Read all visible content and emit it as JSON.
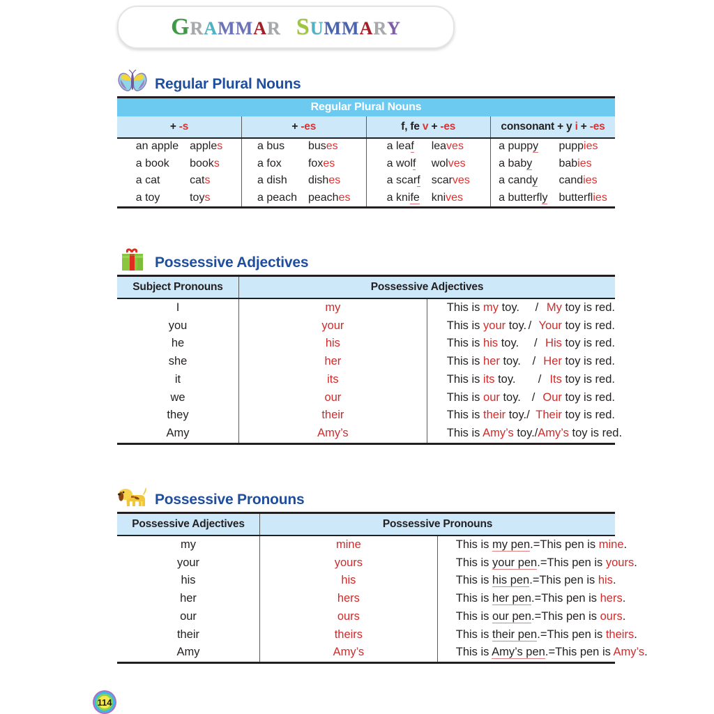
{
  "page": {
    "title_letters": [
      {
        "c": "G",
        "color": "#3f9a46",
        "big": true
      },
      {
        "c": "R",
        "color": "#a6a8ab",
        "big": false
      },
      {
        "c": "A",
        "color": "#4fb3c4",
        "big": false
      },
      {
        "c": "M",
        "color": "#6b73b8",
        "big": false
      },
      {
        "c": "M",
        "color": "#6b73b8",
        "big": false
      },
      {
        "c": "A",
        "color": "#a02028",
        "big": false
      },
      {
        "c": "R",
        "color": "#a6a8ab",
        "big": false
      },
      {
        "c": " ",
        "color": "#000000",
        "big": false
      },
      {
        "c": "S",
        "color": "#9fc63b",
        "big": true
      },
      {
        "c": "U",
        "color": "#4fb3c4",
        "big": false
      },
      {
        "c": "M",
        "color": "#4a63ad",
        "big": false
      },
      {
        "c": "M",
        "color": "#4a63ad",
        "big": false
      },
      {
        "c": "A",
        "color": "#a02028",
        "big": false
      },
      {
        "c": "R",
        "color": "#a6a8ab",
        "big": false
      },
      {
        "c": "Y",
        "color": "#7b5ea7",
        "big": false
      }
    ],
    "title_plain": "GRAMMAR SUMMARY",
    "page_number": "114",
    "accent_heading": "#1f4e9c",
    "accent_red": "#e03030",
    "bar_blue": "#6cc9ef",
    "subhead_blue": "#cde9f9"
  },
  "section1": {
    "icon": "butterfly-icon",
    "heading": "Regular Plural Nouns",
    "table_title": "Regular Plural Nouns",
    "columns": [
      {
        "prefix": "+ ",
        "suffix": "-s",
        "suffix_red": true,
        "mid": "",
        "mid_red": false,
        "tail": "",
        "tail_red": false
      },
      {
        "prefix": "+ ",
        "suffix": "-es",
        "suffix_red": true,
        "mid": "",
        "mid_red": false,
        "tail": "",
        "tail_red": false
      },
      {
        "prefix": "f, fe  ",
        "suffix": "v",
        "suffix_red": true,
        "mid": " + ",
        "mid_red": false,
        "tail": "-es",
        "tail_red": true
      },
      {
        "prefix": "consonant + y  ",
        "suffix": "i",
        "suffix_red": true,
        "mid": " + ",
        "mid_red": false,
        "tail": "-es",
        "tail_red": true
      }
    ],
    "cells": [
      {
        "rows": [
          {
            "sing": "an apple",
            "sing_ul": "",
            "plural_base": "apple",
            "plural_suffix": "s"
          },
          {
            "sing": "a book",
            "sing_ul": "",
            "plural_base": "book",
            "plural_suffix": "s"
          },
          {
            "sing": "a cat",
            "sing_ul": "",
            "plural_base": "cat",
            "plural_suffix": "s"
          },
          {
            "sing": "a toy",
            "sing_ul": "",
            "plural_base": "toy",
            "plural_suffix": "s"
          }
        ]
      },
      {
        "rows": [
          {
            "sing": "a bus",
            "sing_ul": "",
            "plural_base": "bus",
            "plural_suffix": "es"
          },
          {
            "sing": "a fox",
            "sing_ul": "",
            "plural_base": "fox",
            "plural_suffix": "es"
          },
          {
            "sing": "a dish",
            "sing_ul": "",
            "plural_base": "dish",
            "plural_suffix": "es"
          },
          {
            "sing": "a peach",
            "sing_ul": "",
            "plural_base": "peach",
            "plural_suffix": "es"
          }
        ]
      },
      {
        "rows": [
          {
            "sing": "a lea",
            "sing_ul": "f",
            "plural_base": "lea",
            "plural_suffix": "ves"
          },
          {
            "sing": "a wol",
            "sing_ul": "f",
            "plural_base": "wol",
            "plural_suffix": "ves"
          },
          {
            "sing": "a scar",
            "sing_ul": "f",
            "plural_base": "scar",
            "plural_suffix": "ves"
          },
          {
            "sing": "a kni",
            "sing_ul": "fe",
            "plural_base": "kni",
            "plural_suffix": "ves"
          }
        ]
      },
      {
        "rows": [
          {
            "sing": "a pupp",
            "sing_ul": "y",
            "plural_base": "pupp",
            "plural_suffix": "ies"
          },
          {
            "sing": "a bab",
            "sing_ul": "y",
            "plural_base": "bab",
            "plural_suffix": "ies"
          },
          {
            "sing": "a cand",
            "sing_ul": "y",
            "plural_base": "cand",
            "plural_suffix": "ies"
          },
          {
            "sing": "a butterfl",
            "sing_ul": "y",
            "plural_base": "butterfl",
            "plural_suffix": "ies"
          }
        ]
      }
    ]
  },
  "section2": {
    "icon": "gift-icon",
    "heading": "Possessive Adjectives",
    "header_left": "Subject Pronouns",
    "header_right": "Possessive Adjectives",
    "rows": [
      {
        "subject": "I",
        "adj": "my",
        "s1_pre": "This is ",
        "s1_mid": "my",
        "s1_post": " toy.",
        "slash": "/",
        "s2_mid": "My",
        "s2_post": " toy is red."
      },
      {
        "subject": "you",
        "adj": "your",
        "s1_pre": "This is ",
        "s1_mid": "your",
        "s1_post": " toy.",
        "slash": "/",
        "s2_mid": "Your",
        "s2_post": " toy is red."
      },
      {
        "subject": "he",
        "adj": "his",
        "s1_pre": "This is ",
        "s1_mid": "his",
        "s1_post": " toy.",
        "slash": "/",
        "s2_mid": "His",
        "s2_post": " toy is red."
      },
      {
        "subject": "she",
        "adj": "her",
        "s1_pre": "This is ",
        "s1_mid": "her",
        "s1_post": " toy.",
        "slash": "/",
        "s2_mid": "Her",
        "s2_post": " toy is red."
      },
      {
        "subject": "it",
        "adj": "its",
        "s1_pre": "This is ",
        "s1_mid": "its",
        "s1_post": " toy.",
        "slash": "/",
        "s2_mid": "Its",
        "s2_post": " toy is red."
      },
      {
        "subject": "we",
        "adj": "our",
        "s1_pre": "This is ",
        "s1_mid": "our",
        "s1_post": " toy.",
        "slash": "/",
        "s2_mid": "Our",
        "s2_post": " toy is red."
      },
      {
        "subject": "they",
        "adj": "their",
        "s1_pre": "This is ",
        "s1_mid": "their",
        "s1_post": " toy.",
        "slash": "/",
        "s2_mid": "Their",
        "s2_post": " toy is red."
      },
      {
        "subject": "Amy",
        "adj": "Amy’s",
        "s1_pre": "This is ",
        "s1_mid": "Amy’s",
        "s1_post": " toy.",
        "slash": "/",
        "s2_mid": "Amy’s",
        "s2_post": " toy is red."
      }
    ]
  },
  "section3": {
    "icon": "dog-icon",
    "heading": "Possessive Pronouns",
    "header_left": "Possessive Adjectives",
    "header_right": "Possessive Pronouns",
    "rows": [
      {
        "adj": "my",
        "pron": "mine",
        "s1_pre": "This is ",
        "s1_ul": "my pen",
        "s1_post": ".",
        "eq": "=",
        "s2_pre": "This pen is ",
        "s2_mid": "mine",
        "s2_post": "."
      },
      {
        "adj": "your",
        "pron": "yours",
        "s1_pre": "This is ",
        "s1_ul": "your pen",
        "s1_post": ".",
        "eq": "=",
        "s2_pre": "This pen is ",
        "s2_mid": "yours",
        "s2_post": "."
      },
      {
        "adj": "his",
        "pron": "his",
        "s1_pre": "This is ",
        "s1_ul": "his pen",
        "s1_post": ".",
        "eq": "=",
        "s2_pre": "This pen is ",
        "s2_mid": "his",
        "s2_post": "."
      },
      {
        "adj": "her",
        "pron": "hers",
        "s1_pre": "This is ",
        "s1_ul": "her pen",
        "s1_post": ".",
        "eq": "=",
        "s2_pre": "This pen is ",
        "s2_mid": "hers",
        "s2_post": "."
      },
      {
        "adj": "our",
        "pron": "ours",
        "s1_pre": "This is ",
        "s1_ul": "our pen",
        "s1_post": ".",
        "eq": "=",
        "s2_pre": "This pen is ",
        "s2_mid": "ours",
        "s2_post": "."
      },
      {
        "adj": "their",
        "pron": "theirs",
        "s1_pre": "This is ",
        "s1_ul": "their pen",
        "s1_post": ".",
        "eq": "=",
        "s2_pre": "This pen is ",
        "s2_mid": "theirs",
        "s2_post": "."
      },
      {
        "adj": "Amy",
        "pron": "Amy’s",
        "s1_pre": "This is ",
        "s1_ul": "Amy’s pen",
        "s1_post": ".",
        "eq": "=",
        "s2_pre": "This pen is ",
        "s2_mid": "Amy’s",
        "s2_post": "."
      }
    ]
  }
}
